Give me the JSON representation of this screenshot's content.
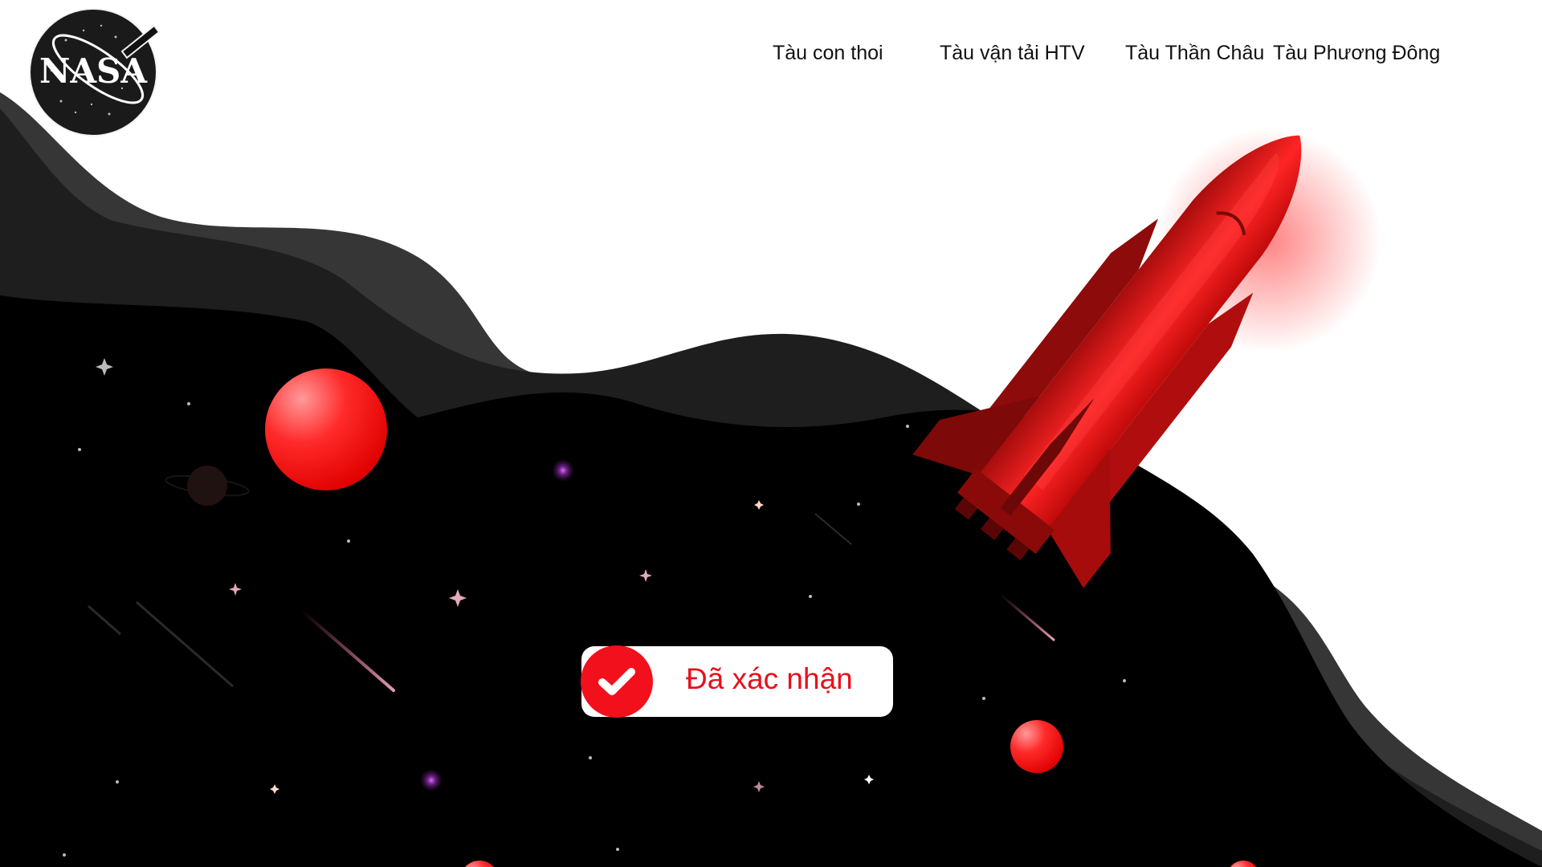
{
  "brand": {
    "logo_text": "NASA",
    "logo_icon": "nasa-meatball-logo"
  },
  "nav": {
    "items": [
      {
        "label": "Tàu con thoi"
      },
      {
        "label": "Tàu vận tải HTV"
      },
      {
        "label": "Tàu Thần Châu"
      },
      {
        "label": "Tàu Phương Đông"
      }
    ]
  },
  "status": {
    "label": "Đã xác nhận",
    "icon": "checkmark-icon"
  },
  "colors": {
    "accent": "#f2101c",
    "background": "#ffffff",
    "space": "#000000",
    "wave_dark": "#1e1e1e",
    "wave_light": "#363636"
  }
}
